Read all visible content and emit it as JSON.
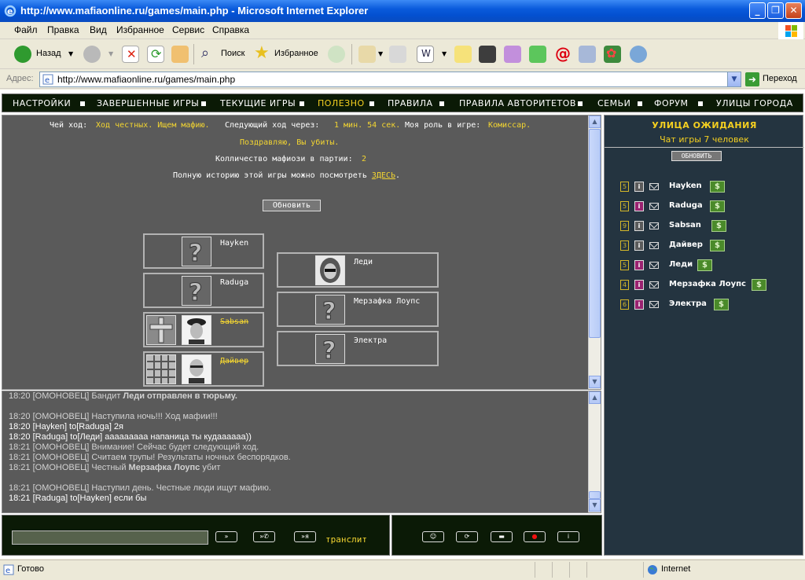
{
  "window": {
    "title": "http://www.mafiaonline.ru/games/main.php - Microsoft Internet Explorer"
  },
  "menu": [
    "Файл",
    "Правка",
    "Вид",
    "Избранное",
    "Сервис",
    "Справка"
  ],
  "toolbar": {
    "back_label": "Назад",
    "search_label": "Поиск",
    "favorites_label": "Избранное"
  },
  "address": {
    "label": "Адрес:",
    "url": "http://www.mafiaonline.ru/games/main.php",
    "go_label": "Переход"
  },
  "nav": [
    {
      "label": "НАСТРОЙКИ",
      "active": false
    },
    {
      "label": "ЗАВЕРШЕННЫЕ ИГРЫ",
      "active": false
    },
    {
      "label": "ТЕКУЩИЕ ИГРЫ",
      "active": false
    },
    {
      "label": "ПОЛЕЗНО",
      "active": true
    },
    {
      "label": "ПРАВИЛА",
      "active": false
    },
    {
      "label": "ПРАВИЛА АВТОРИТЕТОВ",
      "active": false
    },
    {
      "label": "СЕМЬИ",
      "active": false
    },
    {
      "label": "ФОРУМ",
      "active": false
    },
    {
      "label": "УЛИЦЫ ГОРОДА",
      "active": false
    }
  ],
  "game": {
    "turn_label": "Чей ход:",
    "turn_value": "Ход честных. Ищем мафию.",
    "next_label": "Следующий ход через:",
    "next_value": "1 мин. 54 сек.",
    "role_label": "Моя роль в игре:",
    "role_value": "Комиссар.",
    "killed_msg": "Поздравляю, Вы убиты.",
    "mafia_count_label": "Колличество мафиози в партии:",
    "mafia_count_value": "2",
    "history_text": "Полную историю этой игры можно посмотреть",
    "history_link": "ЗДЕСЬ",
    "history_end": ".",
    "refresh_button": "Обновить"
  },
  "players_left": [
    {
      "name": "Hayken",
      "dead": false
    },
    {
      "name": "Raduga",
      "dead": false
    },
    {
      "name": "Sabsan",
      "dead": true
    },
    {
      "name": "Дайвер",
      "dead": true
    }
  ],
  "players_right": [
    {
      "name": "Леди",
      "dead": false
    },
    {
      "name": "Мерзафка Лоупс",
      "dead": false
    },
    {
      "name": "Электра",
      "dead": false
    }
  ],
  "chat": [
    {
      "time": "18:20",
      "text": "[ОМОНОВЕЦ] Бандит ",
      "bold": "Леди отправлен в тюрьму.",
      "style": "gray"
    },
    {
      "time": "18:20",
      "text": "[ОМОНОВЕЦ] Наступила ночь!!! Ход мафии!!!",
      "bold": "",
      "style": "gray"
    },
    {
      "time": "18:20",
      "text": "[Hayken] to[Raduga] 2я",
      "bold": "",
      "style": "wh"
    },
    {
      "time": "18:20",
      "text": "[Raduga] to[Леди] ааааааааа напаница ты кудаааааа))",
      "bold": "",
      "style": "wh"
    },
    {
      "time": "18:21",
      "text": "[ОМОНОВЕЦ] Внимание! Сейчас будет следующий ход.",
      "bold": "",
      "style": "gray"
    },
    {
      "time": "18:21",
      "text": "[ОМОНОВЕЦ] Считаем трупы! Результаты ночных беспорядков.",
      "bold": "",
      "style": "gray"
    },
    {
      "time": "18:21",
      "text": "[ОМОНОВЕЦ] Честный ",
      "bold": "Мерзафка Лоупс",
      "tail": " убит",
      "style": "gray"
    },
    {
      "time": "18:21",
      "text": "[ОМОНОВЕЦ] Наступил день. Честные люди ищут мафию.",
      "bold": "",
      "style": "gray"
    },
    {
      "time": "18:21",
      "text": "[Raduga] to[Hayken] если бы",
      "bold": "",
      "style": "wh"
    }
  ],
  "input": {
    "value": "",
    "translit_label": "транслит",
    "btn_send": "»",
    "btn_private": "»✆",
    "btn_me": "»я"
  },
  "street": {
    "title": "УЛИЦА ОЖИДАНИЯ",
    "subtitle": "Чат игры 7 человек",
    "refresh_button": "ОБНОВИТЬ",
    "users": [
      {
        "level": "5",
        "name": "Hayken",
        "female": false
      },
      {
        "level": "5",
        "name": "Raduga",
        "female": true
      },
      {
        "level": "9",
        "name": "Sabsan",
        "female": false
      },
      {
        "level": "3",
        "name": "Дайвер",
        "female": false
      },
      {
        "level": "5",
        "name": "Леди",
        "female": true
      },
      {
        "level": "4",
        "name": "Мерзафка Лоупс",
        "female": true
      },
      {
        "level": "6",
        "name": "Электра",
        "female": true
      }
    ]
  },
  "status": {
    "text": "Готово",
    "zone": "Internet"
  },
  "colors": {
    "accent_yellow": "#f5d020",
    "panel_gray": "#5a5a5a",
    "nav_dark": "#0b1a06",
    "street_bg": "#243440"
  }
}
